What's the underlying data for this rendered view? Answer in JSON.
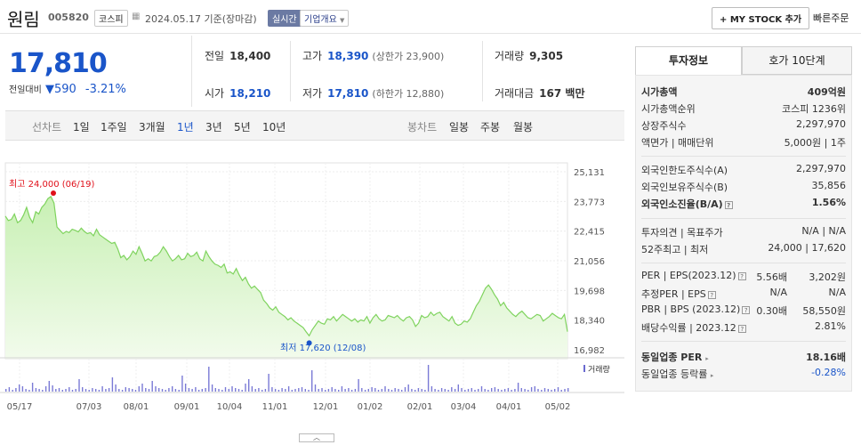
{
  "header": {
    "name": "원림",
    "code": "005820",
    "market": "코스피",
    "date_text": "2024.05.17 기준(장마감)",
    "realtime": "실시간",
    "company_info": "기업개요",
    "mystock": "+ MY STOCK 추가",
    "quick_order": "빠른주문"
  },
  "price": {
    "current": "17,810",
    "change_label": "전일대비",
    "change": "590",
    "change_pct": "-3.21%"
  },
  "stats": {
    "prev_label": "전일",
    "prev": "18,400",
    "high_label": "고가",
    "high": "18,390",
    "high_sub": "(상한가 23,900)",
    "volume_label": "거래량",
    "volume": "9,305",
    "open_label": "시가",
    "open": "18,210",
    "low_label": "저가",
    "low": "17,810",
    "low_sub": "(하한가 12,880)",
    "amount_label": "거래대금",
    "amount": "167 백만"
  },
  "tabs": {
    "line_chart": "선차트",
    "periods": [
      "1일",
      "1주일",
      "3개월",
      "1년",
      "3년",
      "5년",
      "10년"
    ],
    "selected": "1년",
    "candle_chart": "봉차트",
    "candle_periods": [
      "일봉",
      "주봉",
      "월봉"
    ]
  },
  "chart_data": {
    "type": "area",
    "y_ticks": [
      "25,131",
      "23,773",
      "22,415",
      "21,056",
      "19,698",
      "18,340",
      "16,982"
    ],
    "ylim": [
      16982,
      25131
    ],
    "x_ticks": [
      "05/17",
      "07/03",
      "08/01",
      "09/01",
      "10/04",
      "11/01",
      "12/01",
      "01/02",
      "02/01",
      "03/04",
      "04/01",
      "05/02"
    ],
    "max_label": "최고 24,000 (06/19)",
    "min_label": "최저 17,620 (12/08)",
    "volume_label": "거래량",
    "colors": {
      "fill": "#c8f0b4",
      "line": "#7fd35e",
      "max": "#e0101a",
      "min": "#1a55c9"
    },
    "series": [
      {
        "values": [
          23100,
          22900,
          22950,
          23200,
          22800,
          22900,
          23150,
          23500,
          23050,
          22800,
          23300,
          23200,
          23500,
          23650,
          23900,
          24000,
          23700,
          22600,
          22450,
          22300,
          22400,
          22350,
          22500,
          22450,
          22380,
          22550,
          22400,
          22300,
          22350,
          22200,
          22500,
          22250,
          22150,
          22050,
          21950,
          21850,
          21900,
          21600,
          21200,
          21300,
          21100,
          21250,
          21500,
          21350,
          21700,
          21400,
          21050,
          21150,
          21050,
          21250,
          21300,
          21450,
          21700,
          21500,
          21250,
          21050,
          21150,
          21300,
          21100,
          21150,
          21400,
          21250,
          21300,
          21450,
          21150,
          21050,
          21500,
          21250,
          21050,
          20900,
          20850,
          20750,
          20900,
          20500,
          20550,
          20450,
          20700,
          20400,
          20150,
          20300,
          20000,
          19800,
          19900,
          19750,
          19600,
          19250,
          19100,
          18900,
          18800,
          18950,
          18700,
          18600,
          18500,
          18350,
          18450,
          18300,
          18200,
          18100,
          18000,
          17800,
          17620,
          17900,
          18100,
          18300,
          18200,
          18150,
          18400,
          18350,
          18500,
          18300,
          18450,
          18600,
          18500,
          18400,
          18300,
          18400,
          18250,
          18350,
          18300,
          18500,
          18200,
          18450,
          18600,
          18400,
          18300,
          18350,
          18550,
          18500,
          18450,
          18550,
          18400,
          18300,
          18450,
          18500,
          18350,
          18050,
          18200,
          18550,
          18450,
          18500,
          18700,
          18550,
          18650,
          18700,
          18500,
          18400,
          18300,
          18500,
          18200,
          18100,
          18150,
          18300,
          18250,
          18400,
          18700,
          19000,
          19200,
          19500,
          19800,
          19950,
          19750,
          19500,
          19300,
          19000,
          19150,
          18900,
          18750,
          18600,
          18500,
          18650,
          18750,
          18600,
          18450,
          18400,
          18500,
          18600,
          18550,
          18300,
          18400,
          18500,
          18650,
          18550,
          18450,
          18400,
          18600,
          17810
        ]
      }
    ]
  },
  "invest": {
    "tab_on": "투자정보",
    "tab_off": "호가 10단계",
    "rows1": [
      {
        "label": "시가총액",
        "value": "409억원"
      },
      {
        "label": "시가총액순위",
        "value": "코스피 1236위"
      },
      {
        "label": "상장주식수",
        "value": "2,297,970"
      },
      {
        "label": "액면가 | 매매단위",
        "value": "5,000원 | 1주"
      }
    ],
    "rows2": [
      {
        "label": "외국인한도주식수(A)",
        "value": "2,297,970"
      },
      {
        "label": "외국인보유주식수(B)",
        "value": "35,856"
      },
      {
        "label": "외국인소진율(B/A)",
        "value": "1.56%"
      }
    ],
    "rows3": [
      {
        "label": "투자의견 | 목표주가",
        "value": "N/A | N/A"
      },
      {
        "label": "52주최고 | 최저",
        "value": "24,000 | 17,620"
      }
    ],
    "rows4": [
      {
        "label": "PER | EPS(2023.12)",
        "v1": "5.56배",
        "v2": "3,202원"
      },
      {
        "label": "추정PER | EPS",
        "v1": "N/A",
        "v2": "N/A"
      },
      {
        "label": "PBR | BPS (2023.12)",
        "v1": "0.30배",
        "v2": "58,550원"
      },
      {
        "label": "배당수익률 | 2023.12",
        "v1": "",
        "v2": "2.81%"
      }
    ],
    "rows5": [
      {
        "label": "동일업종 PER",
        "value": "18.16배"
      },
      {
        "label": "동일업종 등락률",
        "value": "-0.28%"
      }
    ]
  }
}
